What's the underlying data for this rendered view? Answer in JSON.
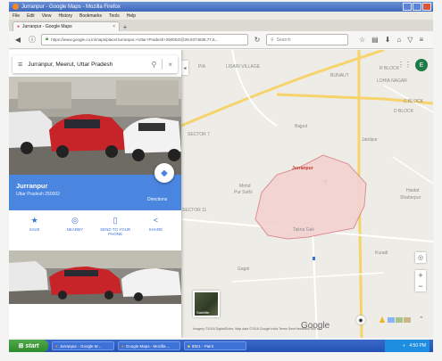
{
  "window": {
    "title": "Jurranpur - Google Maps - Mozilla Firefox"
  },
  "menu": [
    "File",
    "Edit",
    "View",
    "History",
    "Bookmarks",
    "Tools",
    "Help"
  ],
  "tab": {
    "label": "Jurranpur - Google Maps",
    "close": "×",
    "new": "+"
  },
  "nav": {
    "url": "https://www.google.co.in/maps/place/Jurranpur,+Uttar+Pradesh+250002/@28.9374838,77.6...",
    "search_placeholder": "Search"
  },
  "panel": {
    "search_value": "Jurranpur, Meerut, Uttar Pradesh",
    "place_name": "Jurranpur",
    "place_sub": "Uttar Pradesh 250002",
    "directions": "Directions",
    "actions": [
      {
        "icon": "★",
        "label": "SAVE"
      },
      {
        "icon": "◎",
        "label": "NEARBY"
      },
      {
        "icon": "▯",
        "label": "SEND TO YOUR PHONE"
      },
      {
        "icon": "<",
        "label": "SHARE"
      }
    ]
  },
  "map": {
    "labels": {
      "lisari": "LISARI VILLAGE",
      "pia": "PIA",
      "bijnaut": "BIJNAUT",
      "rblock": "R BLOCK",
      "lokhanagar": "LOHIA NAGAR",
      "cblock": "C BLOCK",
      "dblock": "D BLOCK",
      "bajput": "Bajput",
      "jatolpur": "Jatolpur",
      "sector7": "SECTOR 7",
      "jurranpur": "Jurranpur",
      "mohd": "Mohd",
      "pursuthi": "Pur Suthi",
      "haidat": "Haidat",
      "shaherpur": "Shaherpur",
      "sector11": "SECTOR 11",
      "takna": "Takna Gali",
      "kuradi": "Kuradi",
      "gagol": "Gagol"
    },
    "satellite": "Satellite",
    "google": "Google",
    "attribution": "Imagery ©2018 DigitalGlobe, Map data ©2018 Google  India  Terms  Send feedback  500 m",
    "zoom_in": "+",
    "zoom_out": "−",
    "avatar": "E"
  },
  "taskbar": {
    "start": "start",
    "tasks": [
      "Jurranpur - Google M...",
      "Google Maps - Mozilla ...",
      "IDE1 - Paint"
    ],
    "clock": "4:50 PM"
  },
  "colors": {
    "accent": "#4a86e0",
    "boundary_fill": "#f3d2d2",
    "boundary_stroke": "#d9868a",
    "road": "#f6d36b"
  }
}
